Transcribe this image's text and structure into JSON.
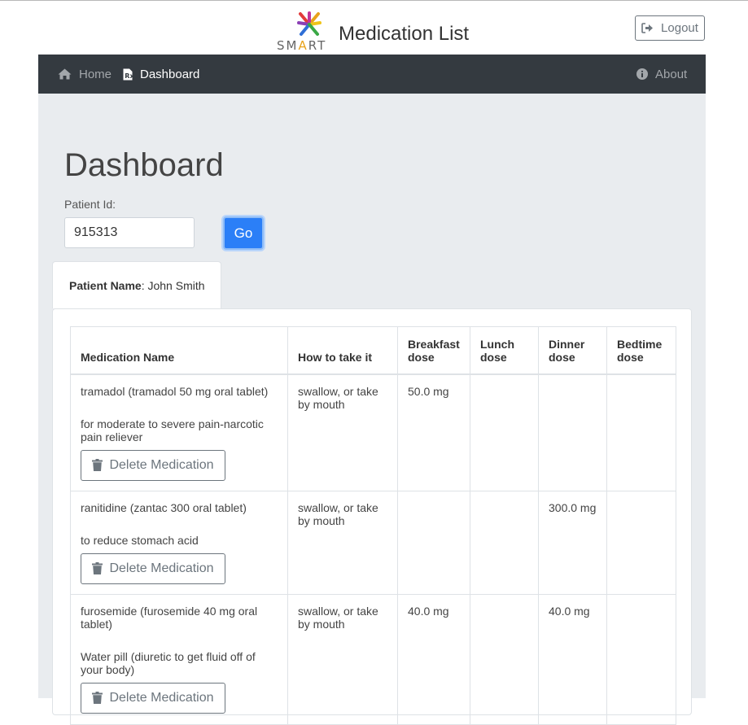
{
  "header": {
    "logo_text_pre": "SM",
    "logo_text_a": "A",
    "logo_text_post": "RT",
    "title": "Medication List",
    "logout_label": "Logout"
  },
  "nav": {
    "home_label": "Home",
    "dashboard_label": "Dashboard",
    "about_label": "About"
  },
  "main": {
    "page_title": "Dashboard",
    "patient_id_label": "Patient Id:",
    "patient_id_value": "915313",
    "go_label": "Go",
    "patient_name_label": "Patient Name",
    "patient_name_value": ": John Smith"
  },
  "table": {
    "headers": [
      "Medication Name",
      "How to take it",
      "Breakfast dose",
      "Lunch dose",
      "Dinner dose",
      "Bedtime dose"
    ],
    "delete_label": "Delete Medication",
    "rows": [
      {
        "name": "tramadol (tramadol 50 mg oral tablet)",
        "description": "for moderate to severe pain-narcotic pain reliever",
        "how": "swallow, or take by mouth",
        "breakfast": "50.0 mg",
        "lunch": "",
        "dinner": "",
        "bedtime": ""
      },
      {
        "name": "ranitidine (zantac 300 oral tablet)",
        "description": "to reduce stomach acid",
        "how": "swallow, or take by mouth",
        "breakfast": "",
        "lunch": "",
        "dinner": "300.0 mg",
        "bedtime": ""
      },
      {
        "name": "furosemide (furosemide 40 mg oral tablet)",
        "description": "Water pill (diuretic to get fluid off of your body)",
        "how": "swallow, or take by mouth",
        "breakfast": "40.0 mg",
        "lunch": "",
        "dinner": "40.0 mg",
        "bedtime": ""
      }
    ]
  },
  "colors": {
    "navbar": "#343a40",
    "primary": "#2b7ff7",
    "background": "#e9ecef"
  },
  "icons": {
    "logout": "sign-out-icon",
    "home": "home-icon",
    "dashboard": "file-prescription-icon",
    "about": "info-circle-icon",
    "delete": "trash-icon"
  }
}
